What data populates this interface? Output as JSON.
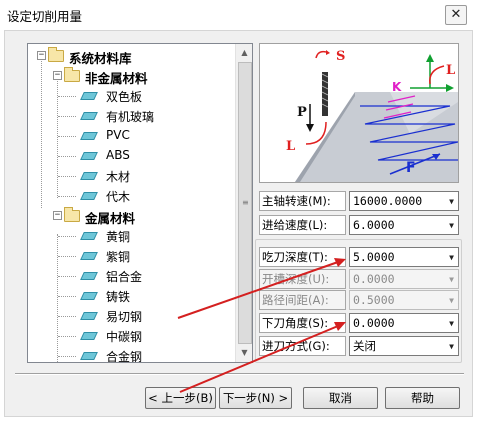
{
  "window": {
    "title": "设定切削用量",
    "close_glyph": "✕"
  },
  "tree": {
    "root": {
      "label": "系统材料库",
      "expander": "−"
    },
    "groups": [
      {
        "label": "非金属材料",
        "expander": "−",
        "items": [
          "双色板",
          "有机玻璃",
          "PVC",
          "ABS",
          "木材",
          "代木"
        ]
      },
      {
        "label": "金属材料",
        "expander": "−",
        "items": [
          "黄铜",
          "紫铜",
          "铝合金",
          "铸铁",
          "易切钢",
          "中碳钢",
          "合金钢"
        ]
      }
    ],
    "scrollbar": {
      "up": "▲",
      "down": "▼",
      "grip": "≡"
    }
  },
  "illustration": {
    "labels": {
      "s": "S",
      "p": "P",
      "l_left": "L",
      "l_right": "L",
      "k": "K",
      "f": "F"
    },
    "colors": {
      "red": "#e02020",
      "blue": "#1a2fd0",
      "green": "#10a030",
      "magenta": "#e020c8"
    }
  },
  "params": [
    {
      "label": "主轴转速(M):",
      "value": "16000.0000",
      "enabled": true
    },
    {
      "label": "进给速度(L):",
      "value": "6.0000",
      "enabled": true
    },
    {
      "label": "吃刀深度(T):",
      "value": "5.0000",
      "enabled": true
    },
    {
      "label": "开槽深度(U):",
      "value": "0.0000",
      "enabled": false
    },
    {
      "label": "路径间距(A):",
      "value": "0.5000",
      "enabled": false
    },
    {
      "label": "下刀角度(S):",
      "value": "0.0000",
      "enabled": true
    },
    {
      "label": "进刀方式(G):",
      "value": "关闭",
      "enabled": true
    }
  ],
  "dropdown_glyph": "▼",
  "buttons": {
    "prev": "< 上一步(B)",
    "next": "下一步(N) >",
    "cancel": "取消",
    "help": "帮助"
  },
  "annotation_color": "#d42020"
}
